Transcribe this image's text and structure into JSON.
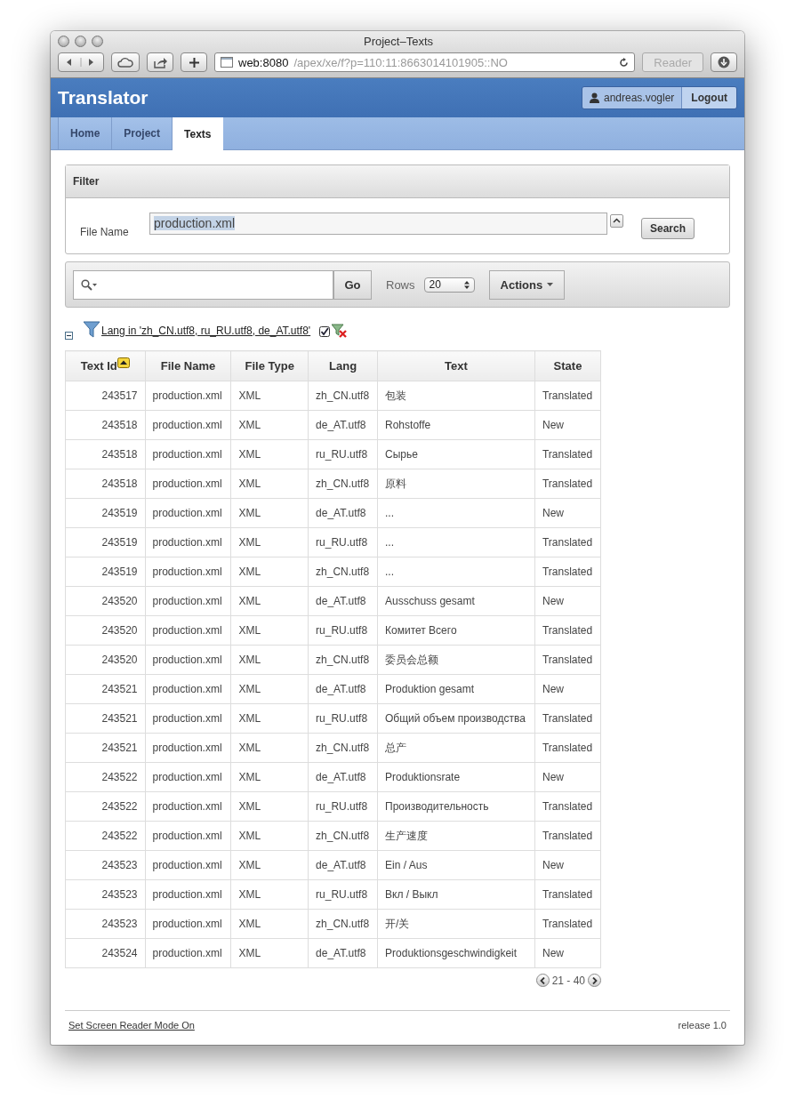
{
  "browser": {
    "title": "Project–Texts",
    "url_host": "web:8080",
    "url_path": "/apex/xe/f?p=110:11:8663014101905::NO",
    "reader": "Reader"
  },
  "header": {
    "title": "Translator",
    "user": "andreas.vogler",
    "logout": "Logout"
  },
  "tabs": [
    {
      "label": "Home",
      "selected": false
    },
    {
      "label": "Project",
      "selected": false
    },
    {
      "label": "Texts",
      "selected": true
    }
  ],
  "filter": {
    "title": "Filter",
    "label": "File Name",
    "value": "production.xml",
    "value_highlighted": true,
    "button": "Search"
  },
  "toolbar": {
    "go": "Go",
    "rows_label": "Rows",
    "rows_value": "20",
    "actions": "Actions"
  },
  "active_filter": "Lang in 'zh_CN.utf8, ru_RU.utf8, de_AT.utf8'",
  "table": {
    "columns": [
      {
        "label": "Text Id",
        "sorted": true
      },
      {
        "label": "File Name",
        "sorted": false
      },
      {
        "label": "File Type",
        "sorted": false
      },
      {
        "label": "Lang",
        "sorted": false
      },
      {
        "label": "Text",
        "sorted": false
      },
      {
        "label": "State",
        "sorted": false
      }
    ],
    "rows": [
      [
        "243517",
        "production.xml",
        "XML",
        "zh_CN.utf8",
        "包装",
        "Translated"
      ],
      [
        "243518",
        "production.xml",
        "XML",
        "de_AT.utf8",
        "Rohstoffe",
        "New"
      ],
      [
        "243518",
        "production.xml",
        "XML",
        "ru_RU.utf8",
        "Сырье",
        "Translated"
      ],
      [
        "243518",
        "production.xml",
        "XML",
        "zh_CN.utf8",
        "原料",
        "Translated"
      ],
      [
        "243519",
        "production.xml",
        "XML",
        "de_AT.utf8",
        "...",
        "New"
      ],
      [
        "243519",
        "production.xml",
        "XML",
        "ru_RU.utf8",
        "...",
        "Translated"
      ],
      [
        "243519",
        "production.xml",
        "XML",
        "zh_CN.utf8",
        "...",
        "Translated"
      ],
      [
        "243520",
        "production.xml",
        "XML",
        "de_AT.utf8",
        "Ausschuss gesamt",
        "New"
      ],
      [
        "243520",
        "production.xml",
        "XML",
        "ru_RU.utf8",
        "Комитет Всего",
        "Translated"
      ],
      [
        "243520",
        "production.xml",
        "XML",
        "zh_CN.utf8",
        "委员会总额",
        "Translated"
      ],
      [
        "243521",
        "production.xml",
        "XML",
        "de_AT.utf8",
        "Produktion gesamt",
        "New"
      ],
      [
        "243521",
        "production.xml",
        "XML",
        "ru_RU.utf8",
        "Общий объем производства",
        "Translated"
      ],
      [
        "243521",
        "production.xml",
        "XML",
        "zh_CN.utf8",
        "总产",
        "Translated"
      ],
      [
        "243522",
        "production.xml",
        "XML",
        "de_AT.utf8",
        "Produktionsrate",
        "New"
      ],
      [
        "243522",
        "production.xml",
        "XML",
        "ru_RU.utf8",
        "Производительность",
        "Translated"
      ],
      [
        "243522",
        "production.xml",
        "XML",
        "zh_CN.utf8",
        "生产速度",
        "Translated"
      ],
      [
        "243523",
        "production.xml",
        "XML",
        "de_AT.utf8",
        "Ein / Aus",
        "New"
      ],
      [
        "243523",
        "production.xml",
        "XML",
        "ru_RU.utf8",
        "Вкл / Выкл",
        "Translated"
      ],
      [
        "243523",
        "production.xml",
        "XML",
        "zh_CN.utf8",
        "开/关",
        "Translated"
      ],
      [
        "243524",
        "production.xml",
        "XML",
        "de_AT.utf8",
        "Produktionsgeschwindigkeit",
        "New"
      ]
    ]
  },
  "pagination": "21 - 40",
  "footer": {
    "link": "Set Screen Reader Mode On",
    "release": "release 1.0"
  }
}
